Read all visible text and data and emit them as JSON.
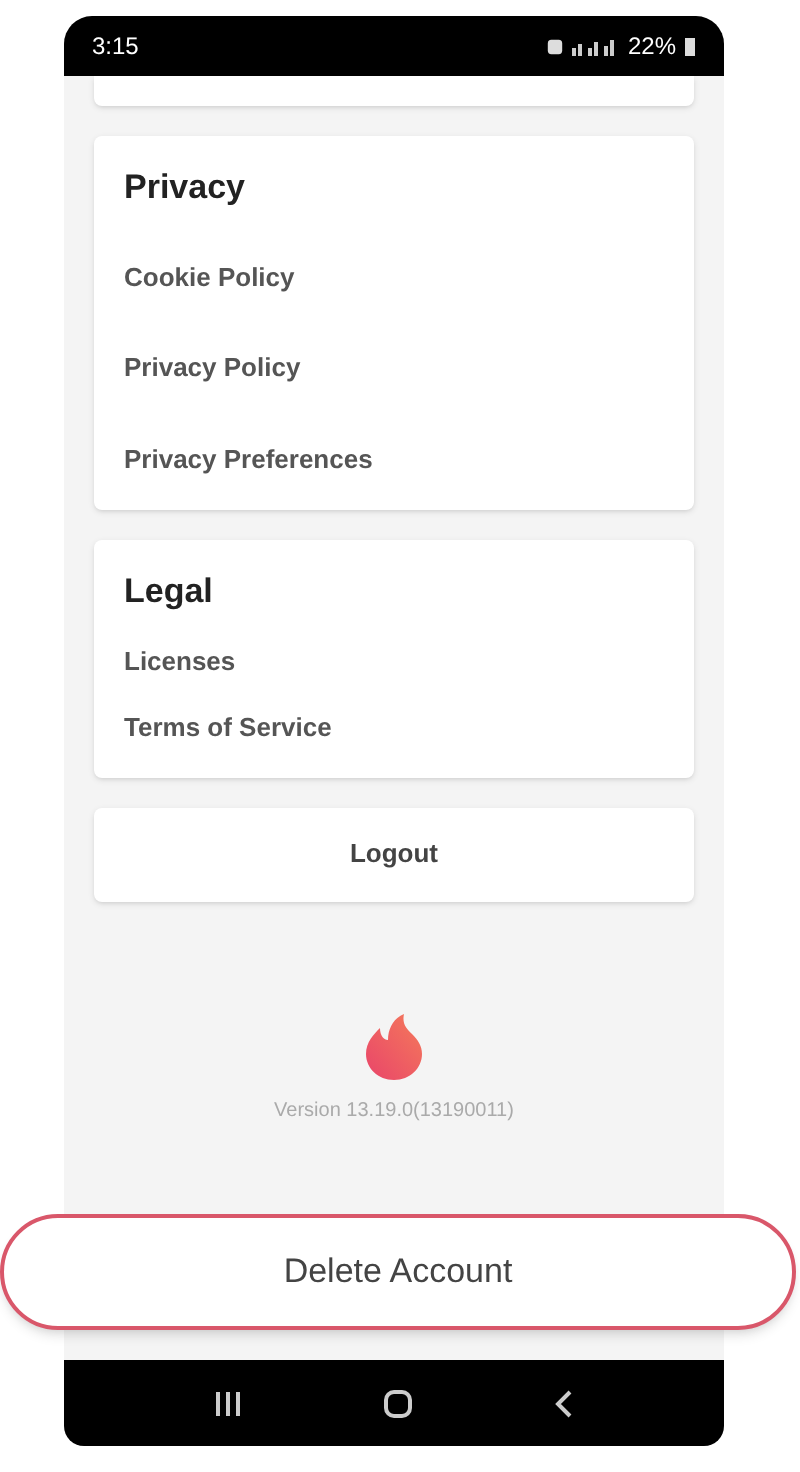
{
  "status_bar": {
    "time": "3:15",
    "battery": "22%"
  },
  "sections": [
    {
      "title": "Privacy",
      "items": [
        "Cookie Policy",
        "Privacy Policy",
        "Privacy Preferences"
      ]
    },
    {
      "title": "Legal",
      "items": [
        "Licenses",
        "Terms of Service"
      ]
    }
  ],
  "logout": "Logout",
  "version": "Version 13.19.0(13190011)",
  "delete_button": "Delete Account"
}
